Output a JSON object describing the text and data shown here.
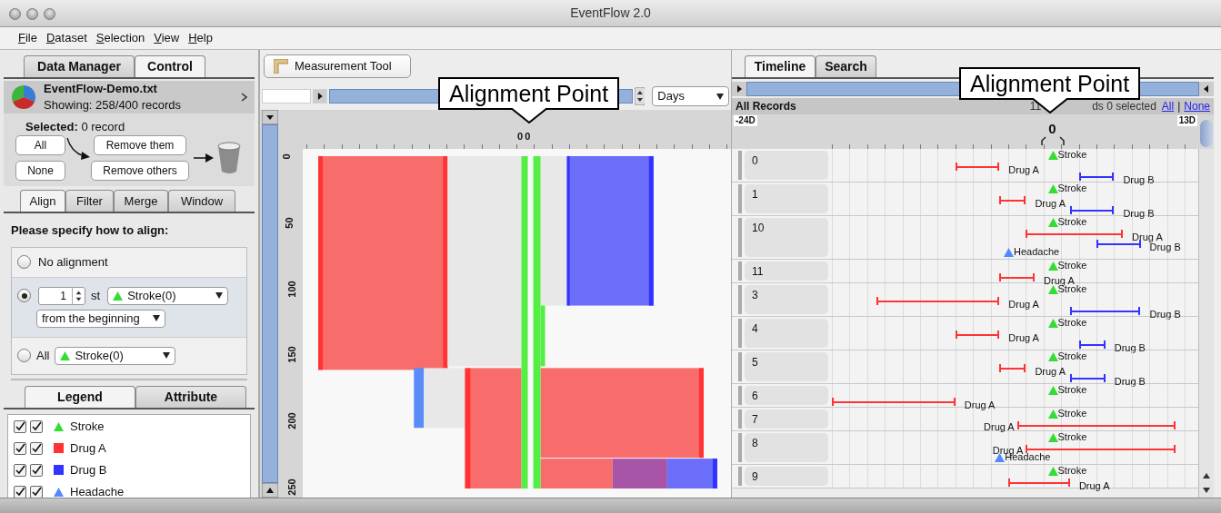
{
  "window": {
    "title": "EventFlow 2.0"
  },
  "menu": [
    "File",
    "Dataset",
    "Selection",
    "View",
    "Help"
  ],
  "left_panel": {
    "tabs": [
      {
        "label": "Data Manager",
        "selected": false
      },
      {
        "label": "Control",
        "selected": true
      }
    ],
    "dataset": {
      "file": "EventFlow-Demo.txt",
      "showing": "Showing: 258/400 records"
    },
    "selected_summary": "**Selected:** 0 record",
    "selection_buttons": [
      "All",
      "None"
    ],
    "remove_buttons": [
      "Remove them",
      "Remove others"
    ],
    "align_tabs": [
      {
        "label": "Align",
        "selected": true
      },
      {
        "label": "Filter",
        "selected": false
      },
      {
        "label": "Merge",
        "selected": false
      },
      {
        "label": "Window",
        "selected": false
      }
    ],
    "align_prompt": "Please specify how to align:",
    "align_options": [
      {
        "kind": "plain",
        "selected": false,
        "label": "No alignment"
      },
      {
        "kind": "nth",
        "selected": true,
        "count": "1",
        "suffix": "st",
        "event": "Stroke(0)",
        "from": "from the beginning"
      },
      {
        "kind": "all",
        "selected": false,
        "label": "All",
        "event": "Stroke(0)"
      }
    ],
    "legend_tabs": [
      {
        "label": "Legend",
        "selected": true
      },
      {
        "label": "Attribute",
        "selected": false
      }
    ],
    "legend": [
      {
        "kind": "point",
        "label": "Stroke",
        "color": "#33dd33",
        "checks": [
          true,
          true
        ]
      },
      {
        "kind": "interval",
        "label": "Drug A",
        "color": "#ff3333",
        "checks": [
          true,
          true
        ]
      },
      {
        "kind": "interval",
        "label": "Drug B",
        "color": "#3333ff",
        "checks": [
          true,
          true
        ]
      },
      {
        "kind": "point",
        "label": "Headache",
        "color": "#5588ff",
        "checks": [
          true,
          true
        ]
      }
    ]
  },
  "middle_panel": {
    "tool_button": "Measurement Tool",
    "unit": "Days",
    "ruler_labels": [
      "0",
      "0"
    ],
    "y_ticks": [
      "0",
      "50",
      "100",
      "150",
      "200",
      "250"
    ],
    "callout": "Alignment Point"
  },
  "right_panel": {
    "tabs": [
      {
        "label": "Timeline",
        "selected": true
      },
      {
        "label": "Search",
        "selected": false
      }
    ],
    "header": "All Records",
    "summary_parts": [
      "11",
      "ds 0 selected"
    ],
    "links": [
      "All",
      "None"
    ],
    "link_separator": "|",
    "axis": {
      "min_label": "-24D",
      "max_label": "13D",
      "zero_label": "0"
    },
    "callout": "Alignment Point",
    "records": [
      {
        "id": "0",
        "events": [
          {
            "kind": "point",
            "label": "Stroke",
            "color": "#33dd33"
          },
          {
            "kind": "interval",
            "label": "Drug A",
            "color": "#ff3333"
          },
          {
            "kind": "interval",
            "label": "Drug B",
            "color": "#3333ff"
          }
        ]
      },
      {
        "id": "1",
        "events": [
          {
            "kind": "point",
            "label": "Stroke",
            "color": "#33dd33"
          },
          {
            "kind": "interval",
            "label": "Drug A",
            "color": "#ff3333"
          },
          {
            "kind": "interval",
            "label": "Drug B",
            "color": "#3333ff"
          }
        ]
      },
      {
        "id": "10",
        "events": [
          {
            "kind": "point",
            "label": "Stroke",
            "color": "#33dd33"
          },
          {
            "kind": "interval",
            "label": "Drug A",
            "color": "#ff3333"
          },
          {
            "kind": "interval",
            "label": "Drug B",
            "color": "#3333ff"
          },
          {
            "kind": "point",
            "label": "Headache",
            "color": "#5588ff"
          }
        ]
      },
      {
        "id": "11",
        "events": [
          {
            "kind": "point",
            "label": "Stroke",
            "color": "#33dd33"
          },
          {
            "kind": "interval",
            "label": "Drug A",
            "color": "#ff3333"
          }
        ]
      },
      {
        "id": "3",
        "events": [
          {
            "kind": "point",
            "label": "Stroke",
            "color": "#33dd33"
          },
          {
            "kind": "interval",
            "label": "Drug A",
            "color": "#ff3333"
          },
          {
            "kind": "interval",
            "label": "Drug B",
            "color": "#3333ff"
          }
        ]
      },
      {
        "id": "4",
        "events": [
          {
            "kind": "point",
            "label": "Stroke",
            "color": "#33dd33"
          },
          {
            "kind": "interval",
            "label": "Drug A",
            "color": "#ff3333"
          },
          {
            "kind": "interval",
            "label": "Drug B",
            "color": "#3333ff"
          }
        ]
      },
      {
        "id": "5",
        "events": [
          {
            "kind": "point",
            "label": "Stroke",
            "color": "#33dd33"
          },
          {
            "kind": "interval",
            "label": "Drug A",
            "color": "#ff3333"
          },
          {
            "kind": "interval",
            "label": "Drug B",
            "color": "#3333ff"
          }
        ]
      },
      {
        "id": "6",
        "events": [
          {
            "kind": "point",
            "label": "Stroke",
            "color": "#33dd33"
          },
          {
            "kind": "interval",
            "label": "Drug A",
            "color": "#ff3333"
          }
        ]
      },
      {
        "id": "7",
        "events": [
          {
            "kind": "point",
            "label": "Stroke",
            "color": "#33dd33"
          },
          {
            "kind": "interval",
            "label": "Drug A",
            "color": "#ff3333"
          }
        ]
      },
      {
        "id": "8",
        "events": [
          {
            "kind": "point",
            "label": "Stroke",
            "color": "#33dd33"
          },
          {
            "kind": "interval",
            "label": "Drug A",
            "color": "#ff3333"
          },
          {
            "kind": "point",
            "label": "Headache",
            "color": "#5588ff"
          }
        ]
      },
      {
        "id": "9",
        "events": [
          {
            "kind": "point",
            "label": "Stroke",
            "color": "#33dd33"
          },
          {
            "kind": "interval",
            "label": "Drug A",
            "color": "#ff3333"
          }
        ]
      }
    ]
  }
}
